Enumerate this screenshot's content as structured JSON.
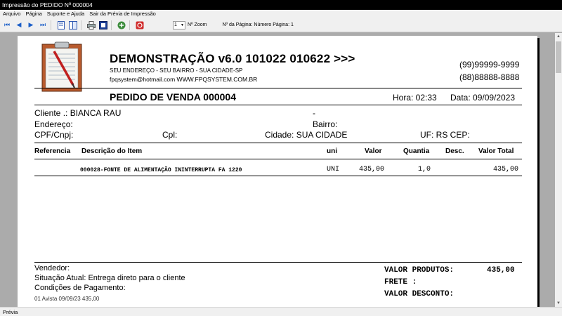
{
  "window": {
    "title": "Impressão do PEDIDO Nº 000004"
  },
  "menu": [
    "Arquivo",
    "Página",
    "Suporte e Ajuda",
    "Sair da Prévia de Impressão"
  ],
  "toolbar": {
    "zoom_value": "1",
    "zoom_label": "Nº Zoom",
    "page_label": "Nº da Página: Número Página: 1",
    "icons": [
      "first-page-icon",
      "prev-page-icon",
      "next-page-icon",
      "last-page-icon",
      "single-page-icon",
      "two-pages-icon",
      "print-icon",
      "print-setup-icon",
      "export-icon",
      "close-icon"
    ]
  },
  "company": {
    "name": "DEMONSTRAÇÃO v6.0 101022 010622 >>>",
    "address": "SEU ENDEREÇO - SEU BAIRRO - SUA CIDADE-SP",
    "contact": "fpqsystem@hotmail.com  WWW.FPQSYSTEM.COM.BR",
    "phone1": "(99)99999-9999",
    "phone2": "(88)88888-8888"
  },
  "order": {
    "title": "PEDIDO DE VENDA 000004",
    "hora": "Hora: 02:33",
    "data": "Data: 09/09/2023"
  },
  "client": {
    "cliente": "Cliente   .: BIANCA RAU",
    "dash": "-",
    "endereco": "Endereço:",
    "bairro": "Bairro:",
    "cpf": "CPF/Cnpj:",
    "cpl": "Cpl:",
    "cidade": "Cidade: SUA CIDADE",
    "uf": "UF: RS  CEP:"
  },
  "table": {
    "headers": {
      "referencia": "Referencia",
      "descricao": "Descrição do Item",
      "uni": "uni",
      "valor": "Valor",
      "quantia": "Quantia",
      "desc": "Desc.",
      "total": "Valor Total"
    },
    "rows": [
      {
        "descricao": "000028-FONTE DE ALIMENTAÇÃO ININTERRUPTA FA 1220",
        "uni": "UNI",
        "valor": "435,00",
        "quantia": "1,0",
        "total": "435,00"
      }
    ]
  },
  "footer": {
    "vendedor": "Vendedor:",
    "situacao": "Situação Atual: Entrega direto para o cliente",
    "condicoes": "Condições de Pagamento:",
    "parcela": "01 Avista       09/09/23    435,00",
    "valor_produtos_label": "VALOR PRODUTOS:",
    "valor_produtos": "435,00",
    "frete_label": "FRETE          :",
    "valor_desconto_label": "VALOR DESCONTO:"
  },
  "status": {
    "text": "Prévia"
  }
}
